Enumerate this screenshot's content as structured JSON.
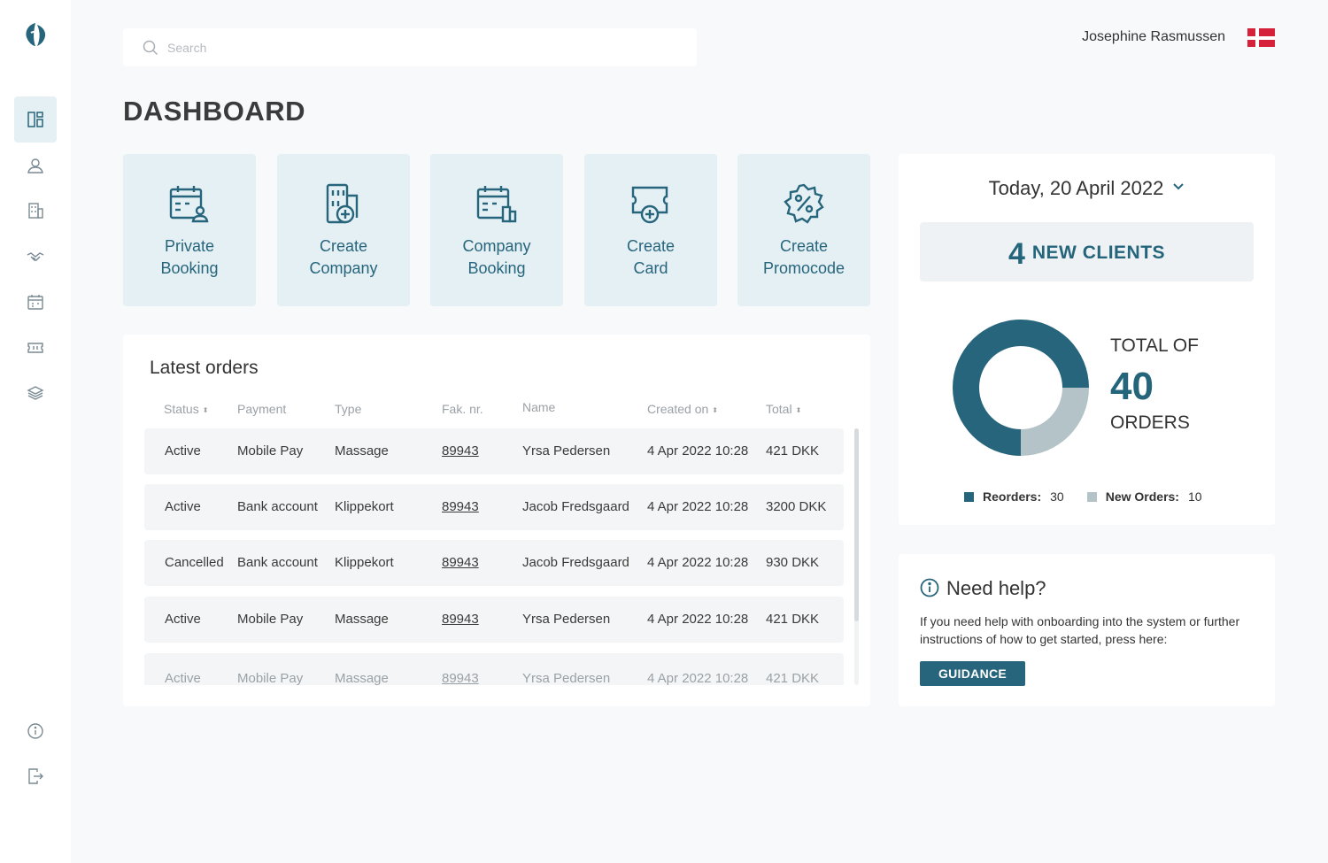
{
  "colors": {
    "accent": "#27657c",
    "tile_bg": "#e4f0f4",
    "light_series": "#b4c3c8",
    "flag_red": "#d6213a"
  },
  "search": {
    "placeholder": "Search"
  },
  "header": {
    "user_name": "Josephine Rasmussen",
    "language_flag": "danish-flag-icon"
  },
  "sidebar": {
    "logo": "logo-icon",
    "items": [
      {
        "icon": "dashboard-icon",
        "active": true
      },
      {
        "icon": "user-icon",
        "active": false
      },
      {
        "icon": "building-icon",
        "active": false
      },
      {
        "icon": "handshake-icon",
        "active": false
      },
      {
        "icon": "calendar-icon",
        "active": false
      },
      {
        "icon": "ticket-icon",
        "active": false
      },
      {
        "icon": "layers-icon",
        "active": false
      }
    ],
    "bottom": [
      {
        "icon": "info-icon"
      },
      {
        "icon": "logout-icon"
      }
    ]
  },
  "page": {
    "title": "DASHBOARD"
  },
  "quick_actions": [
    {
      "label": "Private\nBooking",
      "icon": "calendar-user-icon"
    },
    {
      "label": "Create\nCompany",
      "icon": "building-plus-icon"
    },
    {
      "label": "Company\nBooking",
      "icon": "calendar-building-icon"
    },
    {
      "label": "Create\nCard",
      "icon": "card-plus-icon"
    },
    {
      "label": "Create\nPromocode",
      "icon": "percent-badge-icon"
    }
  ],
  "orders": {
    "title": "Latest orders",
    "columns": [
      {
        "label": "Status",
        "sortable": true
      },
      {
        "label": "Payment",
        "sortable": false
      },
      {
        "label": "Type",
        "sortable": false
      },
      {
        "label": "Fak. nr.",
        "sortable": false
      },
      {
        "label": "Name",
        "sortable": false
      },
      {
        "label": "Created on",
        "sortable": true
      },
      {
        "label": "Total",
        "sortable": true
      }
    ],
    "rows": [
      [
        "Active",
        "Mobile Pay",
        "Massage",
        "89943",
        "Yrsa Pedersen",
        "4 Apr 2022 10:28",
        "421 DKK"
      ],
      [
        "Active",
        "Bank account",
        "Klippekort",
        "89943",
        "Jacob Fredsgaard",
        "4 Apr 2022 10:28",
        "3200 DKK"
      ],
      [
        "Cancelled",
        "Bank account",
        "Klippekort",
        "89943",
        "Jacob Fredsgaard",
        "4 Apr 2022 10:28",
        "930 DKK"
      ],
      [
        "Active",
        "Mobile Pay",
        "Massage",
        "89943",
        "Yrsa Pedersen",
        "4 Apr 2022 10:28",
        "421 DKK"
      ],
      [
        "Active",
        "Mobile Pay",
        "Massage",
        "89943",
        "Yrsa Pedersen",
        "4 Apr 2022 10:28",
        "421 DKK"
      ]
    ]
  },
  "stats": {
    "date_label": "Today, 20 April 2022",
    "new_clients_count": "4",
    "new_clients_label": "NEW CLIENTS",
    "total_of": "TOTAL OF",
    "total_number": "40",
    "total_unit": "ORDERS",
    "legend": [
      {
        "label": "Reorders:",
        "value": "30",
        "color": "#27657c"
      },
      {
        "label": "New Orders:",
        "value": "10",
        "color": "#b4c3c8"
      }
    ]
  },
  "chart_data": {
    "type": "pie",
    "categories": [
      "Reorders",
      "New Orders"
    ],
    "values": [
      30,
      10
    ],
    "colors": [
      "#27657c",
      "#b4c3c8"
    ],
    "donut": true
  },
  "help": {
    "title": "Need help?",
    "text": "If you need help with onboarding into the system or further instructions of how to get started, press here:",
    "button": "GUIDANCE"
  }
}
